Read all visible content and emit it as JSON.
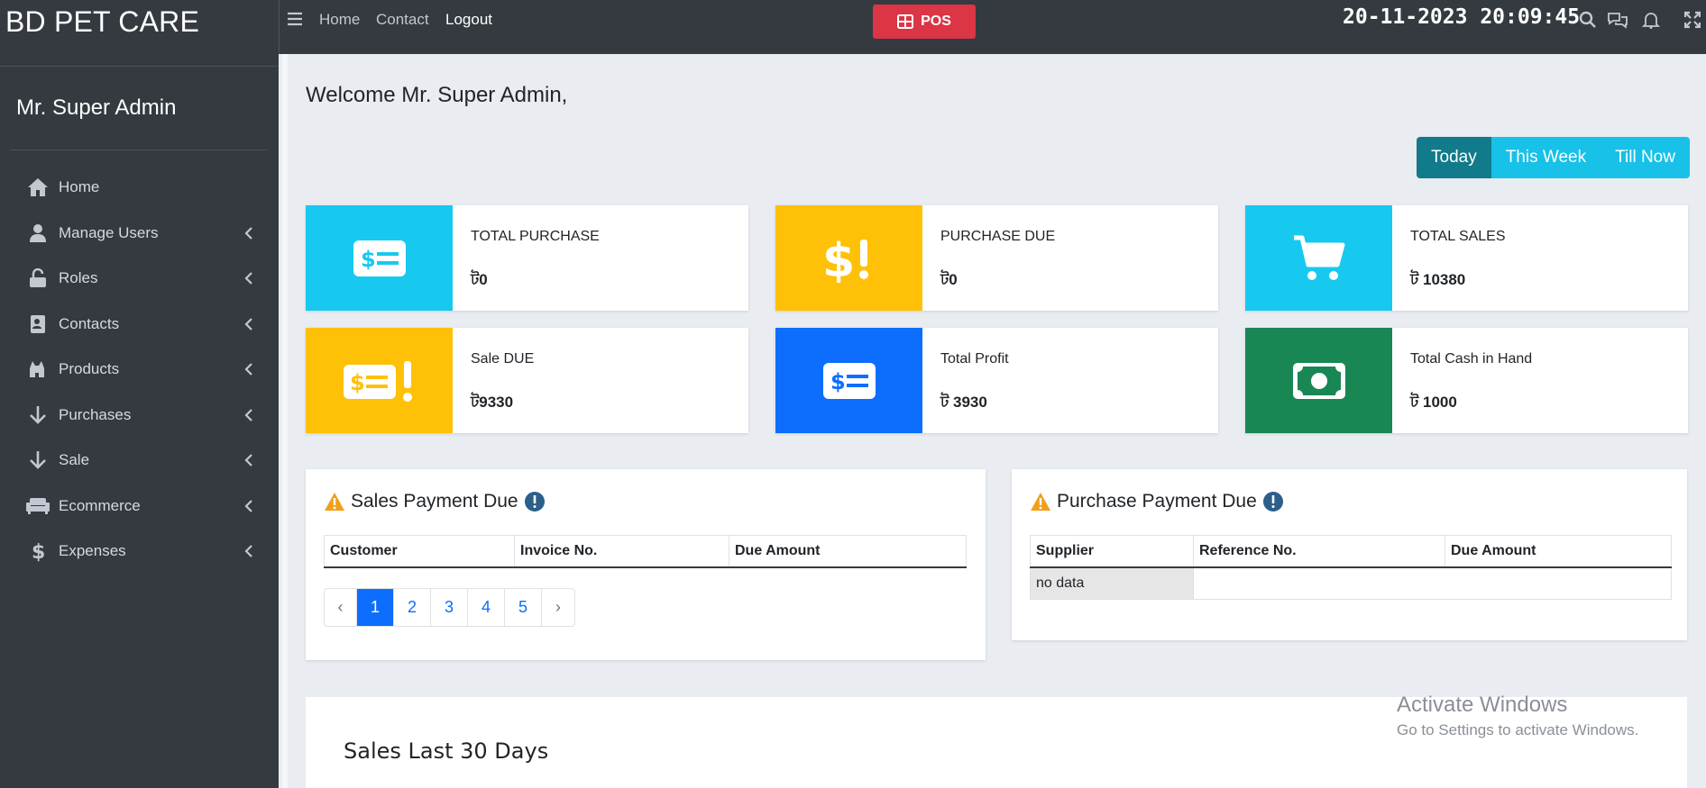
{
  "app": {
    "brand": "BD PET CARE",
    "user_name": "Mr. Super Admin"
  },
  "sidebar": {
    "items": [
      {
        "label": "Home",
        "icon": "home-icon",
        "has_children": false
      },
      {
        "label": "Manage Users",
        "icon": "user-icon",
        "has_children": true
      },
      {
        "label": "Roles",
        "icon": "lock-icon",
        "has_children": true
      },
      {
        "label": "Contacts",
        "icon": "contact-card-icon",
        "has_children": true
      },
      {
        "label": "Products",
        "icon": "pet-icon",
        "has_children": true
      },
      {
        "label": "Purchases",
        "icon": "arrow-down-icon",
        "has_children": true
      },
      {
        "label": "Sale",
        "icon": "arrow-down-icon",
        "has_children": true
      },
      {
        "label": "Ecommerce",
        "icon": "couch-icon",
        "has_children": true
      },
      {
        "label": "Expenses",
        "icon": "dollar-icon",
        "has_children": true
      }
    ]
  },
  "topbar": {
    "links": [
      "Home",
      "Contact",
      "Logout"
    ],
    "pos_label": "POS",
    "datetime": "20-11-2023 20:09:45",
    "icons": [
      "search-icon",
      "chat-icon",
      "bell-icon",
      "fullscreen-icon"
    ]
  },
  "main": {
    "welcome": "Welcome Mr. Super Admin,",
    "period_tabs": [
      {
        "label": "Today",
        "active": true
      },
      {
        "label": "This Week",
        "active": false
      },
      {
        "label": "Till Now",
        "active": false
      }
    ],
    "stats": [
      {
        "title": "TOTAL PURCHASE",
        "value": "ট0",
        "color": "#17c9ef",
        "icon": "money-bill-icon"
      },
      {
        "title": "PURCHASE DUE",
        "value": "ট0",
        "color": "#ffc107",
        "icon": "dollar-exclamation-icon"
      },
      {
        "title": "TOTAL SALES",
        "value": "ট 10380",
        "color": "#17c9ef",
        "icon": "cart-icon"
      },
      {
        "title": "Sale DUE",
        "value": "ট9330",
        "color": "#ffc107",
        "icon": "money-bill-exclamation-icon"
      },
      {
        "title": "Total Profit",
        "value": "ট 3930",
        "color": "#0d6efd",
        "icon": "money-bill-icon"
      },
      {
        "title": "Total Cash in Hand",
        "value": "ট 1000",
        "color": "#198754",
        "icon": "cash-icon"
      }
    ],
    "sales_due": {
      "title": "Sales Payment Due",
      "columns": [
        "Customer",
        "Invoice No.",
        "Due Amount"
      ],
      "pages": [
        "‹",
        "1",
        "2",
        "3",
        "4",
        "5",
        "›"
      ],
      "active_page": "1"
    },
    "purchase_due": {
      "title": "Purchase Payment Due",
      "columns": [
        "Supplier",
        "Reference No.",
        "Due Amount"
      ],
      "empty_text": "no data"
    },
    "chart_title": "Sales Last 30 Days"
  },
  "watermark": {
    "line1": "Activate Windows",
    "line2": "Go to Settings to activate Windows."
  }
}
